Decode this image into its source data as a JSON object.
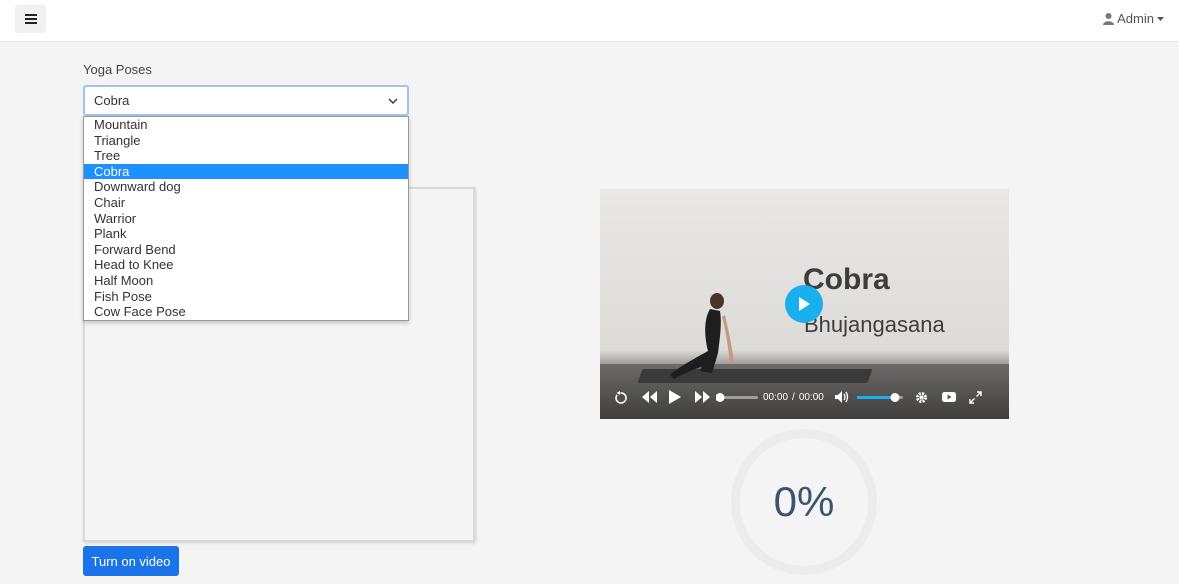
{
  "header": {
    "user_label": "Admin"
  },
  "form": {
    "label": "Yoga Poses",
    "selected": "Cobra",
    "options": [
      "Mountain",
      "Triangle",
      "Tree",
      "Cobra",
      "Downward dog",
      "Chair",
      "Warrior",
      "Plank",
      "Forward Bend",
      "Head to Knee",
      "Half Moon",
      "Fish Pose",
      "Cow Face Pose"
    ],
    "selected_index": 3
  },
  "buttons": {
    "turn_on_video": "Turn on video"
  },
  "video": {
    "overlay_title": "Cobra",
    "overlay_subtitle": "Bhujangasana",
    "current_time": "00:00",
    "separator": "/",
    "duration": "00:00",
    "volume_level": 0.85,
    "seek_progress": 0
  },
  "progress": {
    "value_text": "0%"
  },
  "colors": {
    "accent": "#1a73e8",
    "selected_option": "#1e90ff",
    "play_button": "#1ab0f0",
    "progress_text": "#3b5570"
  }
}
